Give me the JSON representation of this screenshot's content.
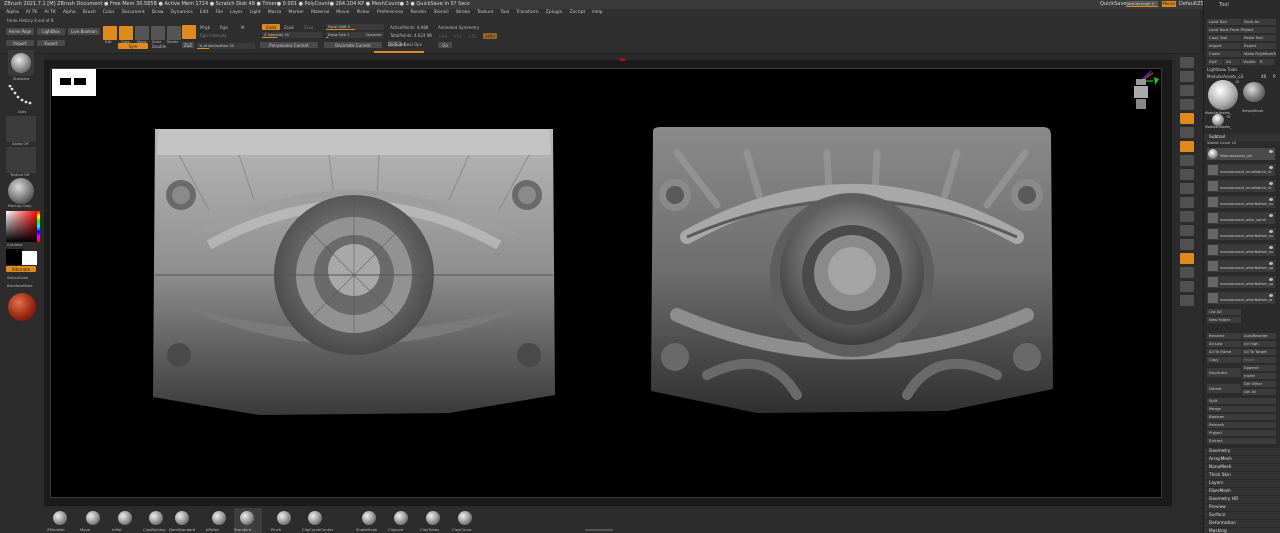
{
  "titlebar": {
    "title": "ZBrush 2021.7.1 [M]   ZBrush Document    ● Free Mem 30.585B ● Active Mem 1724 ● Scratch Disk 48 ● Timer● 0.001 ● PolyCount● 264.104 KP ● MeshCount● 3 ● QuickSave In 5?  Secs",
    "quicksave": "QuickSave",
    "see_through": "See-through  0",
    "menus": "Menus",
    "script": "DefaultZScript"
  },
  "menubar": [
    "Alpha",
    "Brush",
    "Color",
    "Document",
    "Draw",
    "Dynamics",
    "Edit",
    "File",
    "Layer",
    "Light",
    "Macro",
    "Marker",
    "Material",
    "Movie",
    "Picker",
    "Preferences",
    "Render",
    "Stencil",
    "Stroke",
    "Texture",
    "Tool",
    "Transform",
    "Zplugin",
    "Zscript",
    "Help"
  ],
  "menubar_prefix": [
    "Alpha",
    "AI TK",
    "AI TK"
  ],
  "topshelf": {
    "undo": "Undo History 8 out of 8",
    "homepage": "Home Page",
    "lightbox": "LightBox",
    "live_boolean": "Live Boolean",
    "import": "Import",
    "export": "Export",
    "edit": "Edit",
    "draw": "Draw",
    "move": "Move",
    "scale": "Scale",
    "rotate": "Rotate",
    "mrgb": "Mrgb",
    "rgb": "Rgb",
    "m": "M",
    "zadd": "Zadd",
    "zsub": "Zsub",
    "zcut": "Zcut",
    "focal_shift": "Focal Shift  0",
    "z_intensity": "Z Intensity  25",
    "draw_size": "Draw Size  1",
    "rgb_intensity": "Rgb Intensity",
    "dynamic": "Dynamic",
    "active_points": "ActivePoints: 8,988",
    "total_points": "TotalPoints: 4.624 Mil",
    "animated_symmetry": "Animated Symmetry",
    "sym_x": ">X<",
    "sym_y": ">Y<",
    "sym_z": ">Z<",
    "sym_m": ">M<",
    "zbrush_to": "ZoZ",
    "pct_decimation": "% of decimation  20",
    "preprocess": "Pre-process Current",
    "decimate": "Decimate Current",
    "delsub": "DelSubd",
    "boolean_ops": "Bool Ops",
    "go": "Go",
    "double": "Double",
    "sym_label": "Sym"
  },
  "leftshelf": {
    "brush": "Standard",
    "stroke": "Dots",
    "alpha": "Alpha Off",
    "texture": "Texture Off",
    "material": "MatCap Gray",
    "gradient": "Gradient",
    "switch_color": "SwitchColor",
    "alternate": "Alternate",
    "backface": "BackfaceMask"
  },
  "bottomshelf": {
    "brushes": [
      "ZModeler",
      "Move",
      "Inflat",
      "ClayBuildup",
      "DamStandard",
      "hPolish",
      "Standard",
      "Pinch",
      "ClipCurveCenter",
      "SnakeHook",
      "Clipsure",
      "ClayTubes",
      "ClayCurve",
      "ClothCreature"
    ],
    "selected": "Standard",
    "badges": [
      "1",
      "1",
      "1",
      "1"
    ]
  },
  "toolpanel": {
    "title": "Tool",
    "buttons": [
      [
        "Load Tool",
        "Save As"
      ],
      [
        "Load Tools From Project",
        ""
      ],
      [
        "Copy Tool",
        "Paste Tool"
      ],
      [
        "Import",
        "Export"
      ],
      [
        "Clone",
        "Make PolyMesh3D"
      ],
      [
        "GoZ",
        "All",
        "Visible",
        "R"
      ]
    ],
    "lightbox_tools": "Lightbox▸ Tools",
    "current_tool": "ModularAssets_o3",
    "current_tool_count": "48",
    "current_tool_badge": "R",
    "thumb1": "ModularAssets_",
    "thumb2": "SimpleBrush",
    "thumb1_badge": "10",
    "thumb3": "ModularAssets_",
    "thumb3_badge": "70",
    "subtool_head": "Subtool",
    "visible_count": "Visible Count 10",
    "subtools": [
      "ModularAssets_o8",
      "modularAsset_ornaMature_Gl",
      "modularAsset_ornaMature_Gl",
      "modularAsset_pillarBottom_su",
      "modularAsset_pillar_spiral",
      "modularAsset_pillarBottom_su",
      "modularAsset_pillarBottom_su",
      "modularAsset_pillarBottom_sp",
      "modularAsset_pillarBottom_sp",
      "modularAsset_pillarBottom_la"
    ],
    "list_all": "List All",
    "new_folder": "New Folder",
    "rename": "Rename",
    "autoreorder": "AutoReorder",
    "all_low": "All Low",
    "all_high": "All High",
    "all_to_home": "All To Home",
    "all_to_target": "All To Target",
    "copy": "Copy",
    "paste": "Paste",
    "duplicate": "Duplicate",
    "append": "Append",
    "insert": "Insert",
    "delete": "Delete",
    "del_other": "Del Other",
    "del_all": "Del All",
    "split": "Split",
    "merge": "Merge",
    "boolean": "Boolean",
    "remesh": "Remesh",
    "project": "Project",
    "extract": "Extract",
    "sections": [
      "Geometry",
      "ArrayMesh",
      "NanoMesh",
      "Thick Skin",
      "Layers",
      "FiberMesh",
      "Geometry HD",
      "Preview",
      "Surface",
      "Deformation",
      "Masking"
    ]
  },
  "colors": {
    "accent": "#e08a1e",
    "panel": "#2b2b2b",
    "canvas": "#000000"
  }
}
